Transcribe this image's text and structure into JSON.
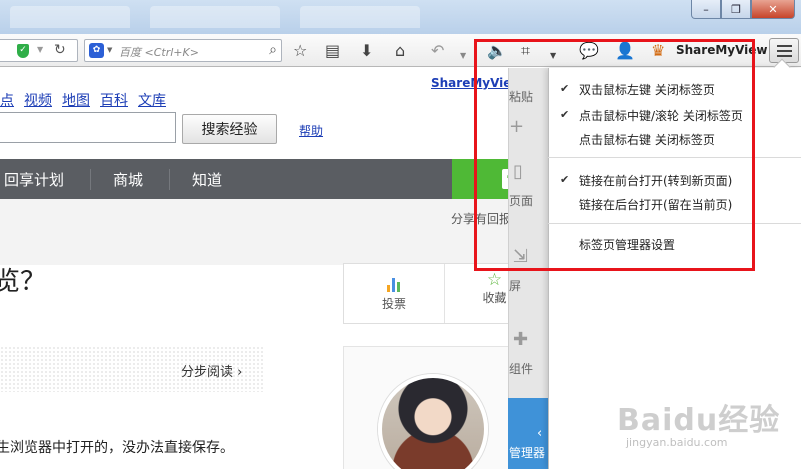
{
  "toolbar": {
    "search_placeholder": "百度 <Ctrl+K>",
    "sharemyview_label": "ShareMyView"
  },
  "page": {
    "sharemyview_link": "ShareMyView",
    "nav_links": [
      "点",
      "视频",
      "地图",
      "百科",
      "文库"
    ],
    "search_button": "搜索经验",
    "help_link": "帮助",
    "dark_nav": [
      "回享计划",
      "商城",
      "知道"
    ],
    "share_text": "分享有回报",
    "heading": "览？",
    "vote_label": "投票",
    "collect_label": "收藏",
    "step_read": "分步阅读",
    "bottom_text": "生浏览器中打开的，没办法直接保存。",
    "watermark_main": "Baidu经验",
    "watermark_sub": "jingyan.baidu.com"
  },
  "sidebar": {
    "paste": "粘贴",
    "page": "页面",
    "screen": "屏",
    "addons": "组件",
    "manager": "管理器"
  },
  "popup_menu": {
    "items": [
      {
        "label": "双击鼠标左键 关闭标签页",
        "checked": true
      },
      {
        "label": "点击鼠标中键/滚轮 关闭标签页",
        "checked": true
      },
      {
        "label": "点击鼠标右键 关闭标签页",
        "checked": false
      },
      {
        "label": "链接在前台打开(转到新页面)",
        "checked": true
      },
      {
        "label": "链接在后台打开(留在当前页)",
        "checked": false
      },
      {
        "label": "标签页管理器设置",
        "checked": false
      }
    ],
    "check_mark": "✔"
  },
  "colors": {
    "highlight": "#e8141b",
    "accent_green": "#4fb936",
    "link_blue": "#1d3eb6",
    "sidebar_blue": "#3f92d8"
  }
}
